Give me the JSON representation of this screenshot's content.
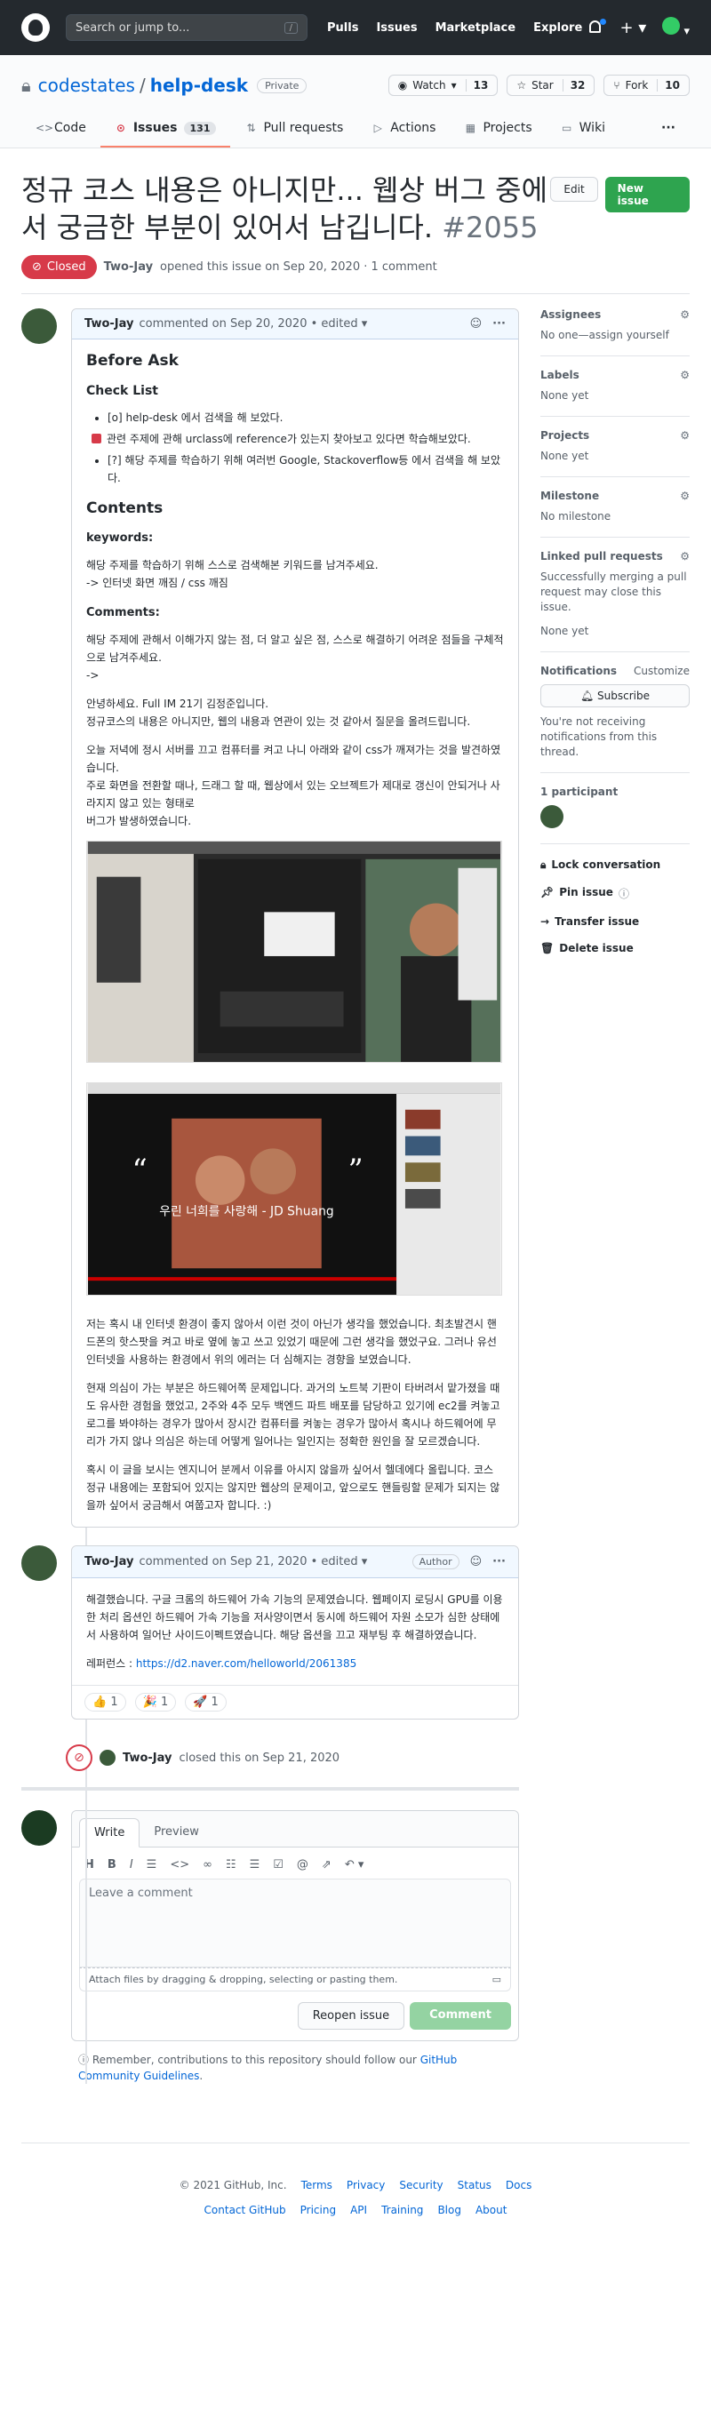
{
  "header": {
    "search_placeholder": "Search or jump to...",
    "slash_key": "/",
    "nav": [
      "Pulls",
      "Issues",
      "Marketplace",
      "Explore"
    ]
  },
  "repo": {
    "owner": "codestates",
    "name": "help-desk",
    "visibility": "Private",
    "watch_label": "Watch",
    "watch_count": "13",
    "star_label": "Star",
    "star_count": "32",
    "fork_label": "Fork",
    "fork_count": "10"
  },
  "tabs": [
    {
      "label": "Code"
    },
    {
      "label": "Issues",
      "count": "131"
    },
    {
      "label": "Pull requests"
    },
    {
      "label": "Actions"
    },
    {
      "label": "Projects"
    },
    {
      "label": "Wiki"
    }
  ],
  "issue": {
    "title": "정규 코스 내용은 아니지만... 웹상 버그 중에서 궁금한 부분이 있어서 남깁니다.",
    "number": "#2055",
    "edit_label": "Edit",
    "new_label": "New issue",
    "state": "Closed",
    "author": "Two-Jay",
    "meta_text": "opened this issue on Sep 20, 2020 · 1 comment"
  },
  "comment1": {
    "author": "Two-Jay",
    "meta": "commented on Sep 20, 2020 • edited ▾",
    "h_before": "Before Ask",
    "h_checklist": "Check List",
    "check1": "[o] help-desk 에서 검색을 해 보았다.",
    "check2": "관련 주제에 관해 urclass에 reference가 있는지 찾아보고 있다면 학습해보았다.",
    "check3": "[?] 해당 주제를 학습하기 위해 여러번 Google, Stackoverflow등 에서 검색을 해 보았다.",
    "h_contents": "Contents",
    "h_keywords": "keywords:",
    "kw1": "해당 주제를 학습하기 위해 스스로 검색해본 키워드를 남겨주세요.",
    "kw2": "-> 인터넷 화면 깨짐 / css 깨짐",
    "h_comments": "Comments:",
    "c1": "해당 주제에 관해서 이해가지 않는 점, 더 알고 싶은 점, 스스로 해결하기 어려운 점들을 구체적으로 남겨주세요.",
    "c2": "->",
    "p1a": "안녕하세요. Full IM 21기 김정준입니다.",
    "p1b": "정규코스의 내용은 아니지만, 웹의 내용과 연관이 있는 것 같아서 질문을 올려드립니다.",
    "p2a": "오늘 저녁에 정시 서버를 끄고 컴퓨터를 켜고 나니 아래와 같이 css가 깨져가는 것을 발견하였습니다.",
    "p2b": "주로 화면을 전환할 때나, 드래그 할 때, 웹상에서 있는 오브젝트가 제대로 갱신이 안되거나 사라지지 않고 있는 형태로",
    "p2c": "버그가 발생하였습니다.",
    "p3": "저는 혹시 내 인터넷 환경이 좋지 않아서 이런 것이 아닌가 생각을 했었습니다. 최초발견시 핸드폰의 핫스팟을 켜고 바로 옆에 놓고 쓰고 있었기 때문에 그런 생각을 했었구요. 그러나 유선 인터넷을 사용하는 환경에서 위의 에러는 더 심해지는 경향을 보였습니다.",
    "p4": "현재 의심이 가는 부분은 하드웨어쪽 문제입니다. 과거의 노트북 기판이 타버려서 맡가졌을 때도 유사한 경험을 했었고, 2주와 4주 모두 백엔드 파트 배포를 담당하고 있기에 ec2를 켜놓고 로그를 봐야하는 경우가 많아서 장시간 컴퓨터를 켜놓는 경우가 많아서 혹시나 하드웨어에 무리가 가지 않나 의심은 하는데 어떻게 일어나는 일인지는 정확한 원인을 잘 모르겠습니다.",
    "p5": "혹시 이 글을 보시는 엔지니어 분께서 이유를 아시지 않을까 싶어서 헬데에다 올립니다. 코스 정규 내용에는 포함되어 있지는 않지만 웹상의 문제이고, 앞으로도 핸들링할 문제가 되지는 않을까 싶어서 궁금해서 여쭙고자 합니다. :)",
    "video_caption": "우린 너희를 사랑해 - JD Shuang"
  },
  "comment2": {
    "author": "Two-Jay",
    "meta": "commented on Sep 21, 2020 • edited ▾",
    "badge": "Author",
    "p1": "해결했습니다. 구글 크롬의 하드웨어 가속 기능의 문제였습니다. 웹페이지 로딩시 GPU를 이용한 처리 옵션인 하드웨어 가속 기능을 저사양이면서 동시에 하드웨어 자원 소모가 심한 상태에서 사용하여 일어난 사이드이펙트였습니다. 해당 옵션을 끄고 재부팅 후 해결하였습니다.",
    "ref_label": "레퍼런스 : ",
    "ref_url": "https://d2.naver.com/helloworld/2061385",
    "reactions": [
      {
        "emoji": "👍",
        "count": "1"
      },
      {
        "emoji": "🎉",
        "count": "1"
      },
      {
        "emoji": "🚀",
        "count": "1"
      }
    ]
  },
  "event": {
    "author": "Two-Jay",
    "text": "closed this on Sep 21, 2020"
  },
  "form": {
    "tab_write": "Write",
    "tab_preview": "Preview",
    "placeholder": "Leave a comment",
    "attach": "Attach files by dragging & dropping, selecting or pasting them.",
    "reopen": "Reopen issue",
    "comment": "Comment",
    "note_pre": "Remember, contributions to this repository should follow our ",
    "note_link": "GitHub Community Guidelines",
    "note_post": "."
  },
  "sidebar": {
    "assignees": {
      "label": "Assignees",
      "value": "No one—assign yourself"
    },
    "labels": {
      "label": "Labels",
      "value": "None yet"
    },
    "projects": {
      "label": "Projects",
      "value": "None yet"
    },
    "milestone": {
      "label": "Milestone",
      "value": "No milestone"
    },
    "linked": {
      "label": "Linked pull requests",
      "value": "Successfully merging a pull request may close this issue.",
      "value2": "None yet"
    },
    "notifications": {
      "label": "Notifications",
      "customize": "Customize",
      "subscribe": "Subscribe",
      "desc": "You're not receiving notifications from this thread."
    },
    "participants": {
      "label": "1 participant"
    },
    "actions": [
      "Lock conversation",
      "Pin issue",
      "Transfer issue",
      "Delete issue"
    ]
  },
  "footer": {
    "copyright": "© 2021 GitHub, Inc.",
    "row1": [
      "Terms",
      "Privacy",
      "Security",
      "Status",
      "Docs"
    ],
    "row2": [
      "Contact GitHub",
      "Pricing",
      "API",
      "Training",
      "Blog",
      "About"
    ]
  }
}
